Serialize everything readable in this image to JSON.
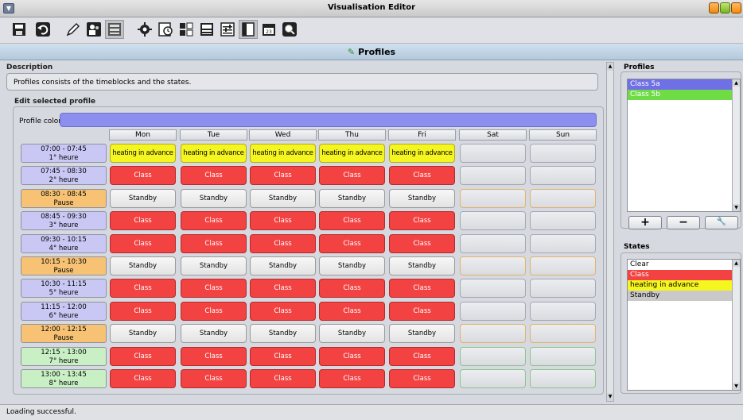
{
  "window": {
    "title": "Visualisation Editor"
  },
  "panel_title": "Profiles",
  "description": {
    "label": "Description",
    "text": "Profiles consists of the timeblocks and the states."
  },
  "edit": {
    "label": "Edit selected profile",
    "profile_color_label": "Profile color",
    "profile_color": "#8d8ff0"
  },
  "days": [
    "Mon",
    "Tue",
    "Wed",
    "Thu",
    "Fri",
    "Sat",
    "Sun"
  ],
  "rows": [
    {
      "time": "07:00 - 07:45",
      "name": "1° heure",
      "type": "c",
      "cells": [
        "heating in advance",
        "heating in advance",
        "heating in advance",
        "heating in advance",
        "heating in advance",
        "",
        ""
      ]
    },
    {
      "time": "07:45 - 08:30",
      "name": "2° heure",
      "type": "c",
      "cells": [
        "Class",
        "Class",
        "Class",
        "Class",
        "Class",
        "",
        ""
      ]
    },
    {
      "time": "08:30 - 08:45",
      "name": "Pause",
      "type": "p",
      "cells": [
        "Standby",
        "Standby",
        "Standby",
        "Standby",
        "Standby",
        "",
        ""
      ]
    },
    {
      "time": "08:45 - 09:30",
      "name": "3° heure",
      "type": "c",
      "cells": [
        "Class",
        "Class",
        "Class",
        "Class",
        "Class",
        "",
        ""
      ]
    },
    {
      "time": "09:30 - 10:15",
      "name": "4° heure",
      "type": "c",
      "cells": [
        "Class",
        "Class",
        "Class",
        "Class",
        "Class",
        "",
        ""
      ]
    },
    {
      "time": "10:15 - 10:30",
      "name": "Pause",
      "type": "p",
      "cells": [
        "Standby",
        "Standby",
        "Standby",
        "Standby",
        "Standby",
        "",
        ""
      ]
    },
    {
      "time": "10:30 - 11:15",
      "name": "5° heure",
      "type": "c",
      "cells": [
        "Class",
        "Class",
        "Class",
        "Class",
        "Class",
        "",
        ""
      ]
    },
    {
      "time": "11:15 - 12:00",
      "name": "6° heure",
      "type": "c",
      "cells": [
        "Class",
        "Class",
        "Class",
        "Class",
        "Class",
        "",
        ""
      ]
    },
    {
      "time": "12:00 - 12:15",
      "name": "Pause",
      "type": "p",
      "cells": [
        "Standby",
        "Standby",
        "Standby",
        "Standby",
        "Standby",
        "",
        ""
      ]
    },
    {
      "time": "12:15 - 13:00",
      "name": "7° heure",
      "type": "g",
      "cells": [
        "Class",
        "Class",
        "Class",
        "Class",
        "Class",
        "",
        ""
      ]
    },
    {
      "time": "13:00 - 13:45",
      "name": "8° heure",
      "type": "g",
      "cells": [
        "Class",
        "Class",
        "Class",
        "Class",
        "Class",
        "",
        ""
      ]
    }
  ],
  "profiles": {
    "title": "Profiles",
    "items": [
      "Class 5a",
      "Class 5b"
    ],
    "buttons": {
      "add": "+",
      "remove": "−",
      "edit": "🔧"
    }
  },
  "states": {
    "title": "States",
    "items": [
      "Clear",
      "Class",
      "heating in advance",
      "Standby"
    ]
  },
  "status": "Loading successful.",
  "colors": {
    "class": "#f24242",
    "heating": "#f5f51f",
    "standby": "#e6e6e6",
    "lesson": "#c9c8f4",
    "pause": "#f7c274",
    "afternoon": "#c9f0c5"
  },
  "toolbar_icons": [
    "save-icon",
    "undo-icon",
    "edit-pencil-icon",
    "users-icon",
    "grid-icon",
    "gear-icon",
    "timer-icon",
    "plugin-icon",
    "layout-icon",
    "sliders-icon",
    "page-icon",
    "calendar-icon",
    "search-icon"
  ]
}
